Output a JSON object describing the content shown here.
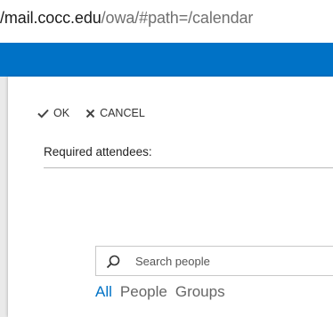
{
  "address_bar": {
    "host": "/mail.cocc.edu",
    "path": "/owa/#path=/calendar"
  },
  "toolbar": {
    "ok_label": "OK",
    "cancel_label": "CANCEL"
  },
  "required_attendees": {
    "label": "Required attendees:"
  },
  "search": {
    "placeholder": "Search people"
  },
  "filter_tabs": {
    "all": "All",
    "people": "People",
    "groups": "Groups"
  },
  "colors": {
    "accent": "#0072c6"
  }
}
